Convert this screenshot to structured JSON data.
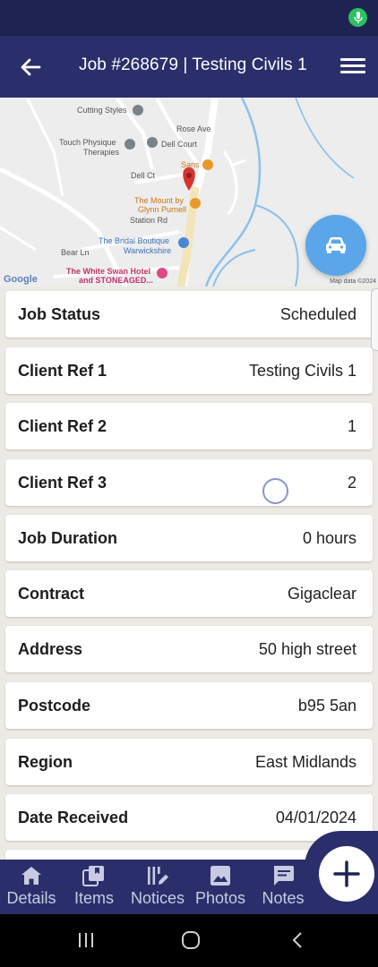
{
  "app_bar": {
    "title": "Job #268679 | Testing Civils 1"
  },
  "map": {
    "labels": {
      "cutting_styles": "Cutting Styles",
      "rose_ave": "Rose Ave",
      "touch_physique": "Touch Physique",
      "therapies": "Therapies",
      "dell_court": "Dell Court",
      "dell_ct": "Dell Ct",
      "sans": "Sans",
      "the_mount_1": "The Mount by",
      "the_mount_2": "Glynn Purnell",
      "station_rd": "Station Rd",
      "bridal_1": "The Bridal Boutique",
      "bridal_2": "Warwickshire",
      "bear_ln": "Bear Ln",
      "white_swan_1": "The White Swan Hotel",
      "white_swan_2": "and STONEAGED..."
    },
    "google": "Google",
    "map_data": "Map data ©2024"
  },
  "details": [
    {
      "label": "Job Status",
      "value": "Scheduled"
    },
    {
      "label": "Client Ref 1",
      "value": "Testing Civils 1"
    },
    {
      "label": "Client Ref 2",
      "value": "1"
    },
    {
      "label": "Client Ref 3",
      "value": "2"
    },
    {
      "label": "Job Duration",
      "value": "0 hours"
    },
    {
      "label": "Contract",
      "value": "Gigaclear"
    },
    {
      "label": "Address",
      "value": "50 high street"
    },
    {
      "label": "Postcode",
      "value": "b95 5an"
    },
    {
      "label": "Region",
      "value": "East Midlands"
    },
    {
      "label": "Date Received",
      "value": "04/01/2024"
    }
  ],
  "bottom_nav": [
    {
      "label": "Details",
      "icon": "home-icon"
    },
    {
      "label": "Items",
      "icon": "items-icon"
    },
    {
      "label": "Notices",
      "icon": "notices-icon"
    },
    {
      "label": "Photos",
      "icon": "photo-icon"
    },
    {
      "label": "Notes",
      "icon": "notes-icon"
    }
  ],
  "colors": {
    "app_bar": "#2a2f6b",
    "status_bar": "#1f2352",
    "fab_car": "#5aa6e9",
    "background": "#eceae4"
  }
}
